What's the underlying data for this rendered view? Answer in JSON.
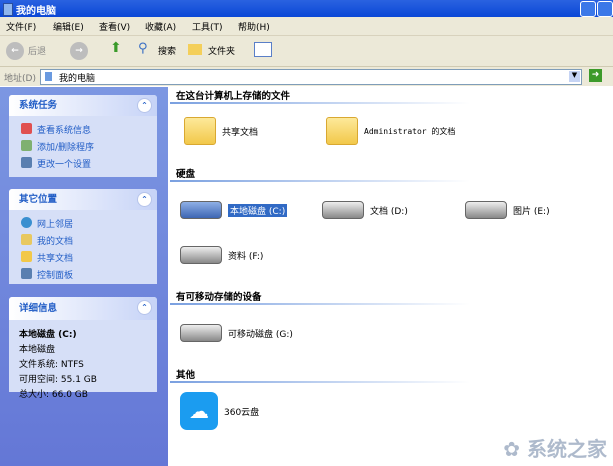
{
  "window": {
    "title": "我的电脑"
  },
  "menu": [
    "文件(F)",
    "编辑(E)",
    "查看(V)",
    "收藏(A)",
    "工具(T)",
    "帮助(H)"
  ],
  "toolbar": {
    "back": "后退",
    "search": "搜索",
    "folders": "文件夹"
  },
  "address": {
    "label": "地址(D)",
    "value": "我的电脑"
  },
  "panels": {
    "tasks": {
      "title": "系统任务",
      "items": [
        "查看系统信息",
        "添加/删除程序",
        "更改一个设置"
      ]
    },
    "places": {
      "title": "其它位置",
      "items": [
        "网上邻居",
        "我的文档",
        "共享文档",
        "控制面板"
      ]
    },
    "details": {
      "title": "详细信息",
      "name": "本地磁盘 (C:)",
      "type": "本地磁盘",
      "fs": "文件系统: NTFS",
      "free": "可用空间: 55.1 GB",
      "total": "总大小: 66.0 GB"
    }
  },
  "sections": {
    "files": {
      "title": "在这台计算机上存储的文件",
      "items": [
        "共享文档",
        "Administrator 的文档"
      ]
    },
    "hdd": {
      "title": "硬盘",
      "items": [
        "本地磁盘 (C:)",
        "文档 (D:)",
        "图片 (E:)",
        "资料 (F:)"
      ]
    },
    "removable": {
      "title": "有可移动存储的设备",
      "items": [
        "可移动磁盘 (G:)"
      ]
    },
    "other": {
      "title": "其他",
      "items": [
        "360云盘"
      ]
    }
  },
  "watermark": "系统之家"
}
